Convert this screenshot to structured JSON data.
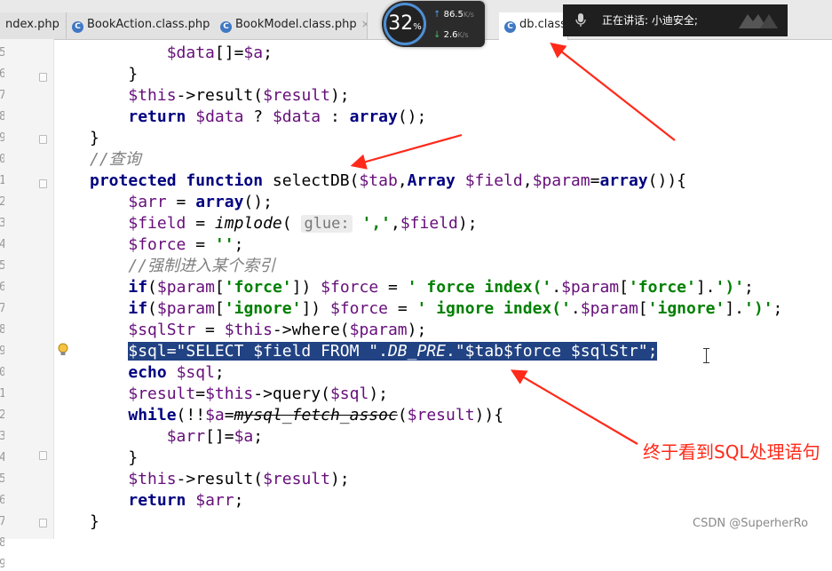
{
  "tabs": [
    {
      "label": "ndex.php",
      "close": "×",
      "active": false,
      "icon": "php-file-icon"
    },
    {
      "label": "BookAction.class.php",
      "close": "×",
      "active": false,
      "icon": "php-class-icon"
    },
    {
      "label": "BookModel.class.php",
      "close": "×",
      "active": false,
      "icon": "php-class-icon"
    },
    {
      "label": "db.class",
      "active": true,
      "icon": "php-class-icon"
    }
  ],
  "tab_icon_letter": "C",
  "perf_widget": {
    "cpu": "32",
    "cpu_unit": "%",
    "upload": "86.5",
    "download": "2.6",
    "unit": "K/s"
  },
  "voice_bar": {
    "text": "正在讲话: 小迪安全;"
  },
  "editor": {
    "line_numbers": [
      "5",
      "6",
      "7",
      "8",
      "9",
      "0",
      "1",
      "2",
      "3",
      "4",
      "5",
      "6",
      "7",
      "8",
      "9",
      "0",
      "1",
      "2",
      "3",
      "4",
      "5",
      "6",
      "7",
      "8",
      "9"
    ],
    "lines": [
      [
        {
          "t": "        "
        },
        {
          "t": "$data",
          "c": "var"
        },
        {
          "t": "[]="
        },
        {
          "t": "$a",
          "c": "var"
        },
        {
          "t": ";"
        }
      ],
      [
        {
          "t": "    }"
        }
      ],
      [
        {
          "t": "    "
        },
        {
          "t": "$this",
          "c": "var"
        },
        {
          "t": "->result("
        },
        {
          "t": "$result",
          "c": "var"
        },
        {
          "t": ");"
        }
      ],
      [
        {
          "t": "    "
        },
        {
          "t": "return",
          "c": "kw"
        },
        {
          "t": " "
        },
        {
          "t": "$data",
          "c": "var"
        },
        {
          "t": " ? "
        },
        {
          "t": "$data",
          "c": "var"
        },
        {
          "t": " : "
        },
        {
          "t": "array",
          "c": "kw"
        },
        {
          "t": "();"
        }
      ],
      [
        {
          "t": "}"
        }
      ],
      [
        {
          "t": "//查询",
          "c": "cmt"
        }
      ],
      [
        {
          "t": "protected",
          "c": "kw"
        },
        {
          "t": " "
        },
        {
          "t": "function",
          "c": "kw"
        },
        {
          "t": " selectDB("
        },
        {
          "t": "$tab",
          "c": "var"
        },
        {
          "t": ","
        },
        {
          "t": "Array",
          "c": "kw"
        },
        {
          "t": " "
        },
        {
          "t": "$field",
          "c": "var"
        },
        {
          "t": ","
        },
        {
          "t": "$param",
          "c": "var"
        },
        {
          "t": "="
        },
        {
          "t": "array",
          "c": "kw"
        },
        {
          "t": "()){"
        }
      ],
      [
        {
          "t": "    "
        },
        {
          "t": "$arr",
          "c": "var"
        },
        {
          "t": " = "
        },
        {
          "t": "array",
          "c": "kw"
        },
        {
          "t": "();"
        }
      ],
      [
        {
          "t": "    "
        },
        {
          "t": "$field",
          "c": "var"
        },
        {
          "t": " = "
        },
        {
          "t": "implode",
          "c": "fn-italic"
        },
        {
          "t": "( "
        },
        {
          "t": "glue:",
          "c": "hint"
        },
        {
          "t": " "
        },
        {
          "t": "','",
          "c": "str"
        },
        {
          "t": ","
        },
        {
          "t": "$field",
          "c": "var"
        },
        {
          "t": ");"
        }
      ],
      [
        {
          "t": "    "
        },
        {
          "t": "$force",
          "c": "var"
        },
        {
          "t": " = "
        },
        {
          "t": "''",
          "c": "str"
        },
        {
          "t": ";"
        }
      ],
      [
        {
          "t": "    "
        },
        {
          "t": "//强制进入某个索引",
          "c": "cmt"
        }
      ],
      [
        {
          "t": "    "
        },
        {
          "t": "if",
          "c": "kw"
        },
        {
          "t": "("
        },
        {
          "t": "$param",
          "c": "var"
        },
        {
          "t": "["
        },
        {
          "t": "'force'",
          "c": "str"
        },
        {
          "t": "]) "
        },
        {
          "t": "$force",
          "c": "var"
        },
        {
          "t": " = "
        },
        {
          "t": "' force index('",
          "c": "str"
        },
        {
          "t": "."
        },
        {
          "t": "$param",
          "c": "var"
        },
        {
          "t": "["
        },
        {
          "t": "'force'",
          "c": "str"
        },
        {
          "t": "]."
        },
        {
          "t": "')'",
          "c": "str"
        },
        {
          "t": ";"
        }
      ],
      [
        {
          "t": "    "
        },
        {
          "t": "if",
          "c": "kw"
        },
        {
          "t": "("
        },
        {
          "t": "$param",
          "c": "var"
        },
        {
          "t": "["
        },
        {
          "t": "'ignore'",
          "c": "str"
        },
        {
          "t": "]) "
        },
        {
          "t": "$force",
          "c": "var"
        },
        {
          "t": " = "
        },
        {
          "t": "' ignore index('",
          "c": "str"
        },
        {
          "t": "."
        },
        {
          "t": "$param",
          "c": "var"
        },
        {
          "t": "["
        },
        {
          "t": "'ignore'",
          "c": "str"
        },
        {
          "t": "]."
        },
        {
          "t": "')'",
          "c": "str"
        },
        {
          "t": ";"
        }
      ],
      [
        {
          "t": "    "
        },
        {
          "t": "$sqlStr",
          "c": "var"
        },
        {
          "t": " = "
        },
        {
          "t": "$this",
          "c": "var"
        },
        {
          "t": "->where("
        },
        {
          "t": "$param",
          "c": "var"
        },
        {
          "t": ");"
        }
      ],
      [
        {
          "t": "    "
        },
        {
          "t": "$sql=\"SELECT $field FROM \".",
          "c": "hl"
        },
        {
          "t": "DB_PRE",
          "c": "hl fn-italic"
        },
        {
          "t": ".\"$tab$force $sqlStr\";",
          "c": "hl"
        }
      ],
      [
        {
          "t": "    "
        },
        {
          "t": "echo",
          "c": "kw"
        },
        {
          "t": " "
        },
        {
          "t": "$sql",
          "c": "var"
        },
        {
          "t": ";"
        }
      ],
      [
        {
          "t": "    "
        },
        {
          "t": "$result",
          "c": "var"
        },
        {
          "t": "="
        },
        {
          "t": "$this",
          "c": "var"
        },
        {
          "t": "->query("
        },
        {
          "t": "$sql",
          "c": "var"
        },
        {
          "t": ");"
        }
      ],
      [
        {
          "t": "    "
        },
        {
          "t": "while",
          "c": "kw"
        },
        {
          "t": "(!!"
        },
        {
          "t": "$a",
          "c": "var"
        },
        {
          "t": "="
        },
        {
          "t": "mysql_fetch_assoc",
          "c": "strike"
        },
        {
          "t": "("
        },
        {
          "t": "$result",
          "c": "var"
        },
        {
          "t": ")){"
        }
      ],
      [
        {
          "t": "        "
        },
        {
          "t": "$arr",
          "c": "var"
        },
        {
          "t": "[]="
        },
        {
          "t": "$a",
          "c": "var"
        },
        {
          "t": ";"
        }
      ],
      [
        {
          "t": "    }"
        }
      ],
      [
        {
          "t": "    "
        },
        {
          "t": "$this",
          "c": "var"
        },
        {
          "t": "->result("
        },
        {
          "t": "$result",
          "c": "var"
        },
        {
          "t": ");"
        }
      ],
      [
        {
          "t": "    "
        },
        {
          "t": "return",
          "c": "kw"
        },
        {
          "t": " "
        },
        {
          "t": "$arr",
          "c": "var"
        },
        {
          "t": ";"
        }
      ],
      [
        {
          "t": "}"
        }
      ]
    ]
  },
  "annotation": "终于看到SQL处理语句",
  "watermark": "CSDN @SuperherRo",
  "colors": {
    "arrow": "#ff2a1a",
    "selection": "#214283",
    "keyword": "#000080",
    "variable": "#660e7a",
    "string": "#008000",
    "comment": "#808080"
  }
}
